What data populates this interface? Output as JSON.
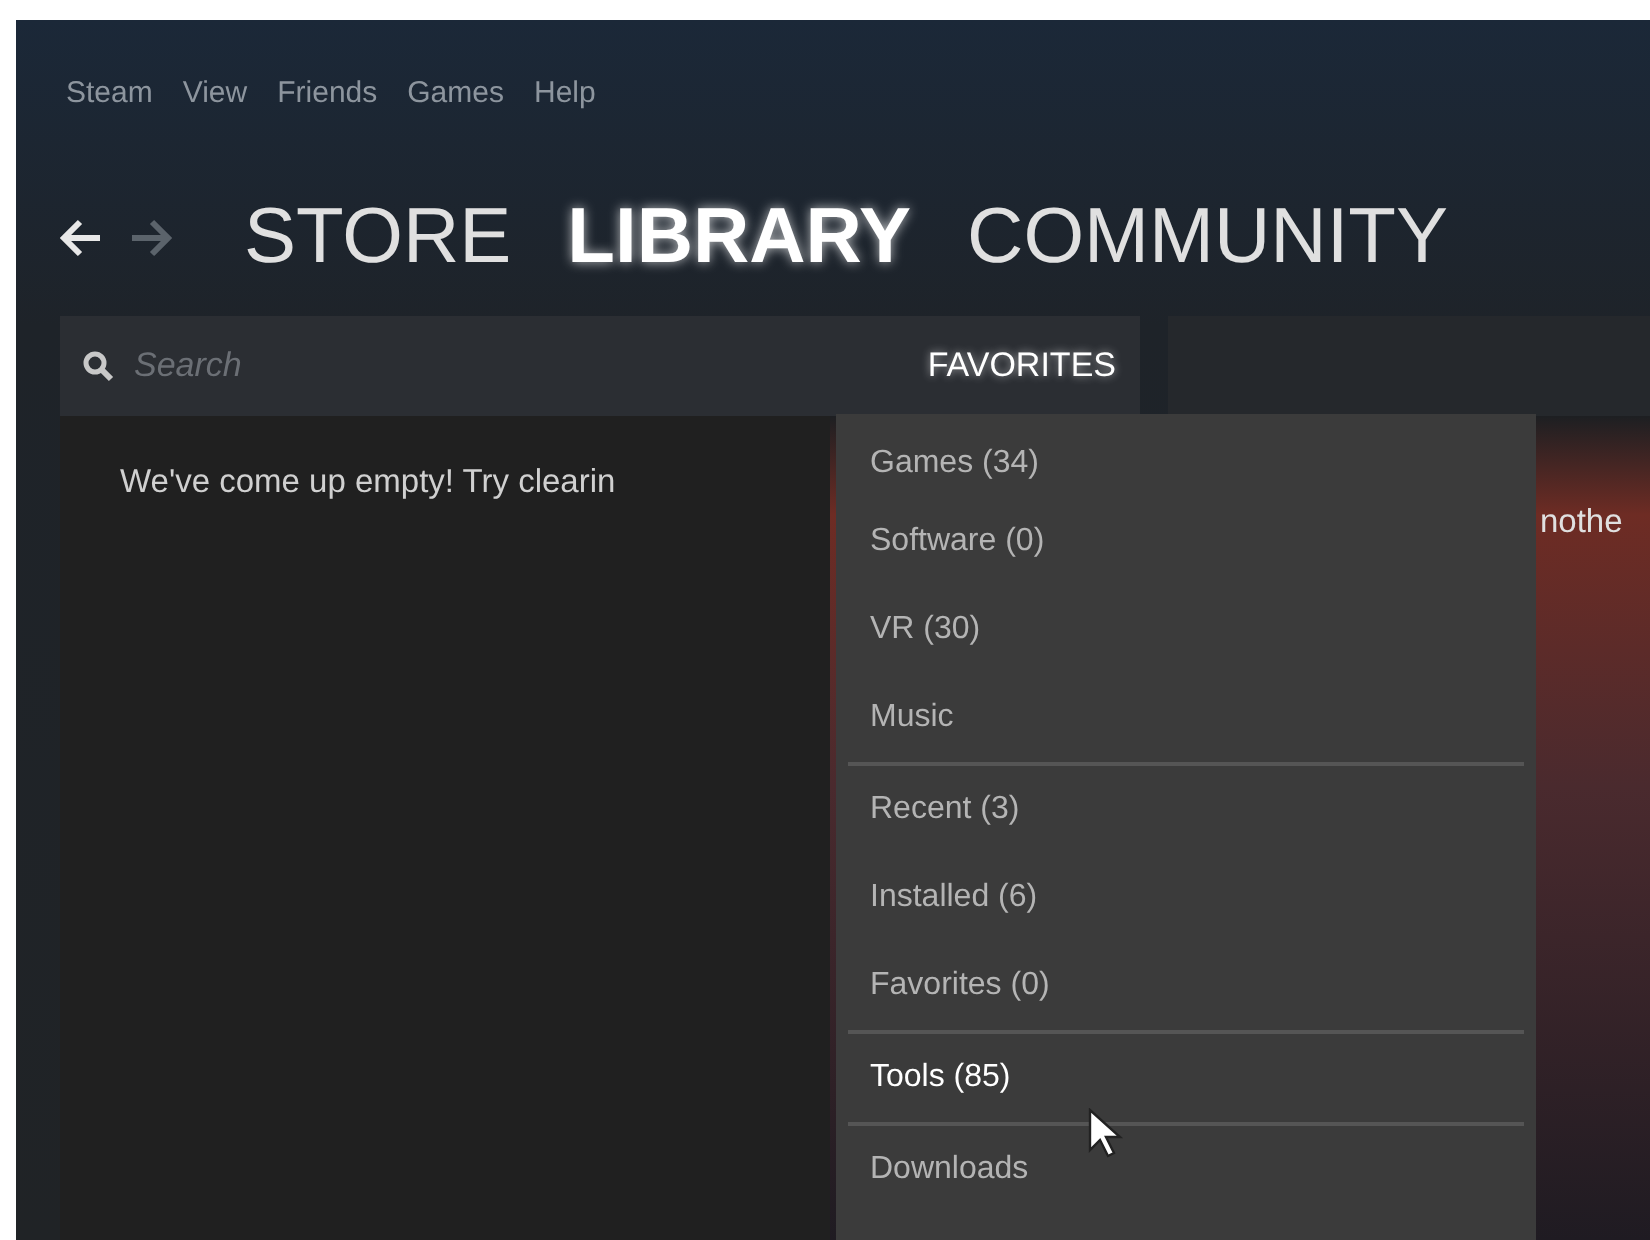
{
  "menu_bar": [
    "Steam",
    "View",
    "Friends",
    "Games",
    "Help"
  ],
  "nav": {
    "back": {
      "disabled": false
    },
    "forward": {
      "disabled": true
    }
  },
  "tabs": [
    {
      "label": "STORE",
      "selected": false
    },
    {
      "label": "LIBRARY",
      "selected": true
    },
    {
      "label": "COMMUNITY",
      "selected": false
    }
  ],
  "search": {
    "placeholder": "Search"
  },
  "filter": {
    "label": "FAVORITES"
  },
  "empty_message": {
    "left_fragment": "We've come up empty! Try clearin",
    "right_fragment": "nothe"
  },
  "dropdown": {
    "groups": [
      [
        {
          "label": "Games (34)",
          "selected": false
        },
        {
          "label": "Software (0)",
          "selected": false
        },
        {
          "label": "VR (30)",
          "selected": false
        },
        {
          "label": "Music",
          "selected": false
        }
      ],
      [
        {
          "label": "Recent (3)",
          "selected": false
        },
        {
          "label": "Installed (6)",
          "selected": false
        },
        {
          "label": "Favorites (0)",
          "selected": false
        }
      ],
      [
        {
          "label": "Tools (85)",
          "selected": true
        }
      ],
      [
        {
          "label": "Downloads",
          "selected": false
        }
      ]
    ]
  }
}
